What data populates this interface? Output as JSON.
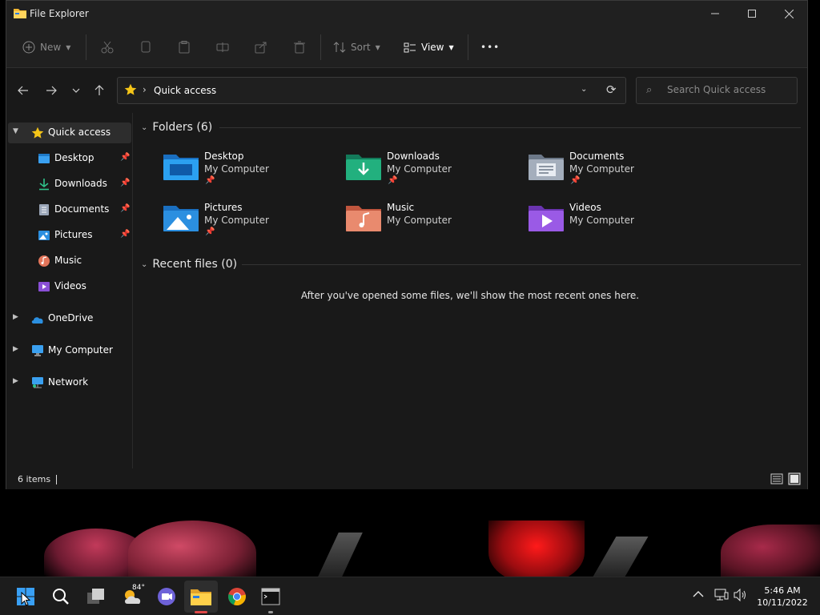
{
  "window": {
    "title": "File Explorer",
    "icon": "folder-icon"
  },
  "toolbar": {
    "new_label": "New",
    "sort_label": "Sort",
    "view_label": "View",
    "more_label": "•••"
  },
  "address": {
    "path": "Quick access",
    "icon": "star-icon"
  },
  "search": {
    "placeholder": "Search Quick access"
  },
  "sidebar": {
    "items": [
      {
        "label": "Quick access",
        "icon": "star-icon",
        "selected": true
      },
      {
        "label": "Desktop",
        "icon": "desktop-icon",
        "pinned": true
      },
      {
        "label": "Downloads",
        "icon": "download-icon",
        "pinned": true
      },
      {
        "label": "Documents",
        "icon": "document-icon",
        "pinned": true
      },
      {
        "label": "Pictures",
        "icon": "pictures-icon",
        "pinned": true
      },
      {
        "label": "Music",
        "icon": "music-icon"
      },
      {
        "label": "Videos",
        "icon": "videos-icon"
      },
      {
        "label": "OneDrive",
        "icon": "onedrive-icon"
      },
      {
        "label": "My Computer",
        "icon": "computer-icon"
      },
      {
        "label": "Network",
        "icon": "network-icon"
      }
    ]
  },
  "main": {
    "folders_heading": "Folders (6)",
    "recent_heading": "Recent files (0)",
    "empty_message": "After you've opened some files, we'll show the most recent ones here.",
    "folders": [
      {
        "name": "Desktop",
        "location": "My Computer",
        "pinned": true,
        "color": "#1e90e0"
      },
      {
        "name": "Downloads",
        "location": "My Computer",
        "pinned": true,
        "color": "#1fa67a"
      },
      {
        "name": "Documents",
        "location": "My Computer",
        "pinned": true,
        "color": "#8a96a8"
      },
      {
        "name": "Pictures",
        "location": "My Computer",
        "pinned": true,
        "color": "#2b8fe0"
      },
      {
        "name": "Music",
        "location": "My Computer",
        "pinned": false,
        "color": "#e2755a"
      },
      {
        "name": "Videos",
        "location": "My Computer",
        "pinned": false,
        "color": "#8a4fd6"
      }
    ]
  },
  "status": {
    "item_count": "6 items"
  },
  "taskbar": {
    "weather_temp": "84°",
    "clock_time": "5:46 AM",
    "clock_date": "10/11/2022"
  }
}
